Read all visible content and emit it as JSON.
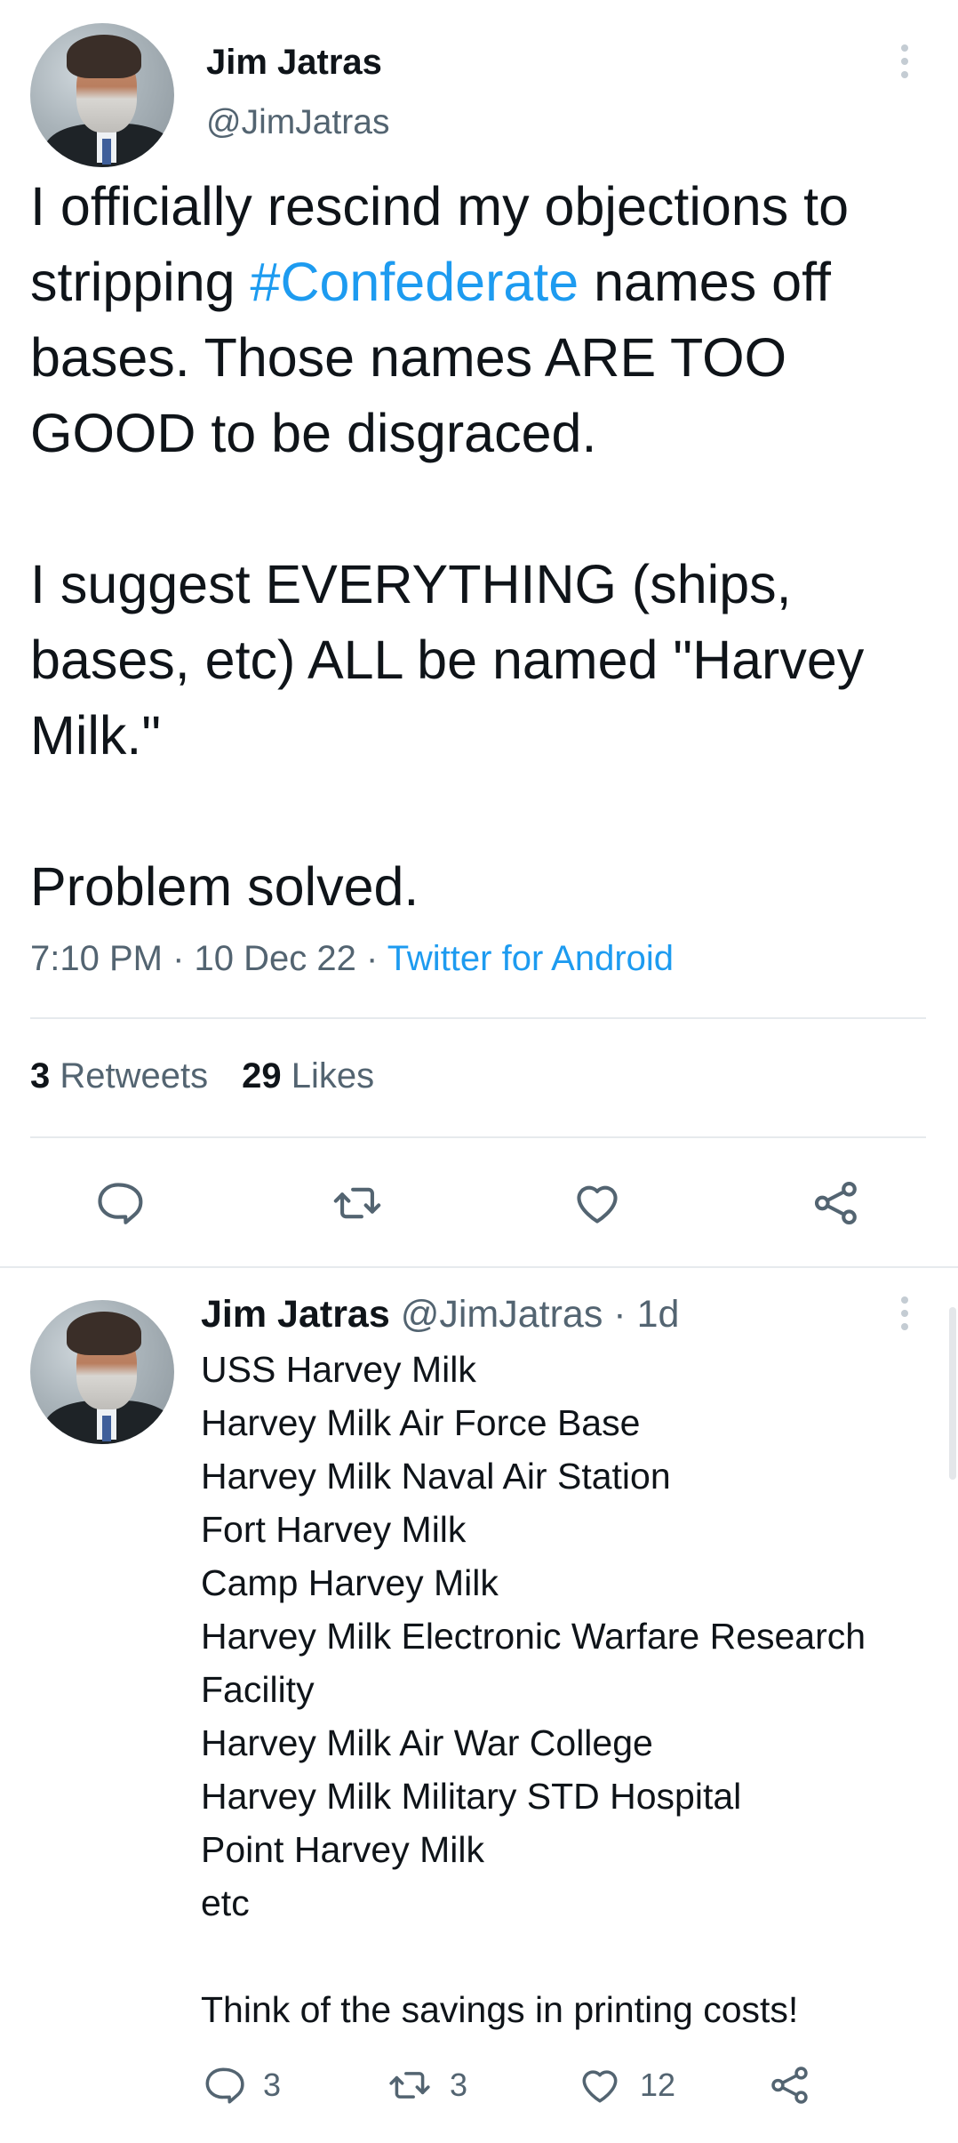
{
  "main_tweet": {
    "author_name": "Jim Jatras",
    "author_handle": "@JimJatras",
    "text_before_hashtag": "I officially rescind my objections to stripping ",
    "hashtag": "#Confederate",
    "text_after_hashtag": " names off bases. Those names ARE TOO GOOD to be disgraced.\n\nI suggest EVERYTHING (ships, bases, etc) ALL be named \"Harvey Milk.\"\n\nProblem solved.",
    "time": "7:10 PM",
    "sep1": " · ",
    "date": "10 Dec 22",
    "sep2": " · ",
    "source": "Twitter for Android",
    "retweet_count": "3",
    "retweet_label": "Retweets",
    "like_count": "29",
    "like_label": "Likes"
  },
  "reply_tweet": {
    "author_name": "Jim Jatras",
    "author_handle": "@JimJatras",
    "age": "· 1d",
    "lines": [
      "USS Harvey Milk",
      "Harvey Milk Air Force Base",
      "Harvey Milk Naval Air Station",
      "Fort Harvey Milk",
      "Camp Harvey Milk",
      "Harvey Milk Electronic Warfare Research Facility",
      "Harvey Milk Air War College",
      "Harvey Milk Military STD Hospital",
      "Point Harvey Milk",
      "etc"
    ],
    "closing": "Think of the savings in printing costs!",
    "reply_count": "3",
    "retweet_count": "3",
    "like_count": "12"
  },
  "icons": {
    "more": "more-vertical-icon",
    "reply": "speech-bubble-icon",
    "retweet": "retweet-arrows-icon",
    "like": "heart-outline-icon",
    "share": "share-nodes-icon"
  },
  "colors": {
    "accent": "#1d9bf0",
    "muted": "#536471",
    "text": "#0f1419",
    "divider": "#e6eaed"
  }
}
